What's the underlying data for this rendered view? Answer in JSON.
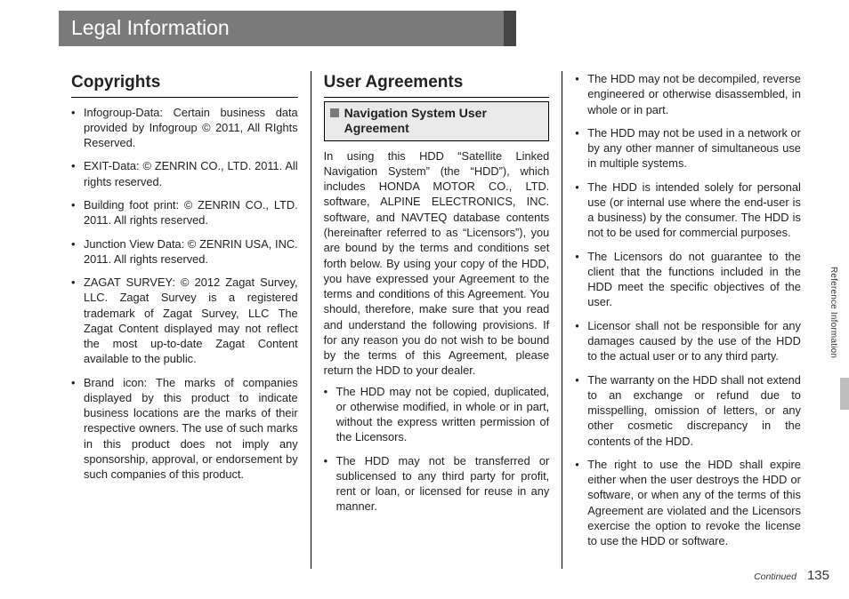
{
  "header": {
    "title": "Legal Information"
  },
  "sideTab": "Reference Information",
  "footer": {
    "continued": "Continued",
    "pageNumber": "135"
  },
  "col1": {
    "heading": "Copyrights",
    "items": [
      "Infogroup-Data: Certain business data provided by Infogroup © 2011, All RIghts Reserved.",
      "EXIT-Data: © ZENRIN CO., LTD. 2011. All rights reserved.",
      "Building foot print: © ZENRIN CO., LTD. 2011. All rights reserved.",
      "Junction View Data: © ZENRIN USA, INC. 2011. All rights reserved.",
      "ZAGAT SURVEY: © 2012 Zagat Survey, LLC. Zagat Survey is a registered trademark of Zagat Survey, LLC The Zagat Content displayed may not reflect the most up-to-date Zagat Content available to the public.",
      "Brand icon: The marks of companies displayed by this product to indicate business locations are the marks of their respective owners.  The use of such marks in this product does not imply any sponsorship, approval, or endorsement by such companies of this product."
    ]
  },
  "col2": {
    "heading": "User Agreements",
    "subheading": "Navigation System User Agreement",
    "intro": "In using this HDD “Satellite Linked Navigation System” (the “HDD”), which includes HONDA MOTOR CO., LTD. software, ALPINE ELECTRONICS, INC. software, and NAVTEQ database contents (hereinafter referred to as “Licensors”), you are bound by the terms and conditions set forth below. By using your copy of the HDD, you have expressed your Agreement to the terms and conditions of this Agreement. You should, therefore, make sure that you read and understand the following provisions. If for any reason you do not wish to be bound by the terms of this Agreement, please return the HDD to your dealer.",
    "items": [
      "The HDD may not be copied, duplicated, or otherwise modified, in whole or in part, without the express written permission of the Licensors.",
      "The HDD may not be transferred or sublicensed to any third party for profit, rent or loan, or licensed for reuse in any manner."
    ]
  },
  "col3": {
    "items": [
      "The HDD may not be decompiled, reverse engineered or otherwise disassembled, in whole or in part.",
      "The HDD may not be used in a network or by any other manner of simultaneous use in multiple systems.",
      "The HDD is intended solely for personal use (or internal use where the end-user is a business) by the consumer. The HDD is not to be used for commercial purposes.",
      "The Licensors do not guarantee to the client that the functions included in the HDD meet the specific objectives of the user.",
      "Licensor shall not be responsible for any damages caused by the use of the HDD to the actual user or to any third party.",
      "The warranty on the HDD shall not extend to an exchange or refund due to misspelling, omission of letters, or any other cosmetic discrepancy in the contents of the HDD.",
      "The right to use the HDD shall expire either when the user destroys the HDD or software, or when any of the terms of this Agreement are violated and the Licensors exercise the option to revoke the license to use the HDD or software."
    ]
  }
}
